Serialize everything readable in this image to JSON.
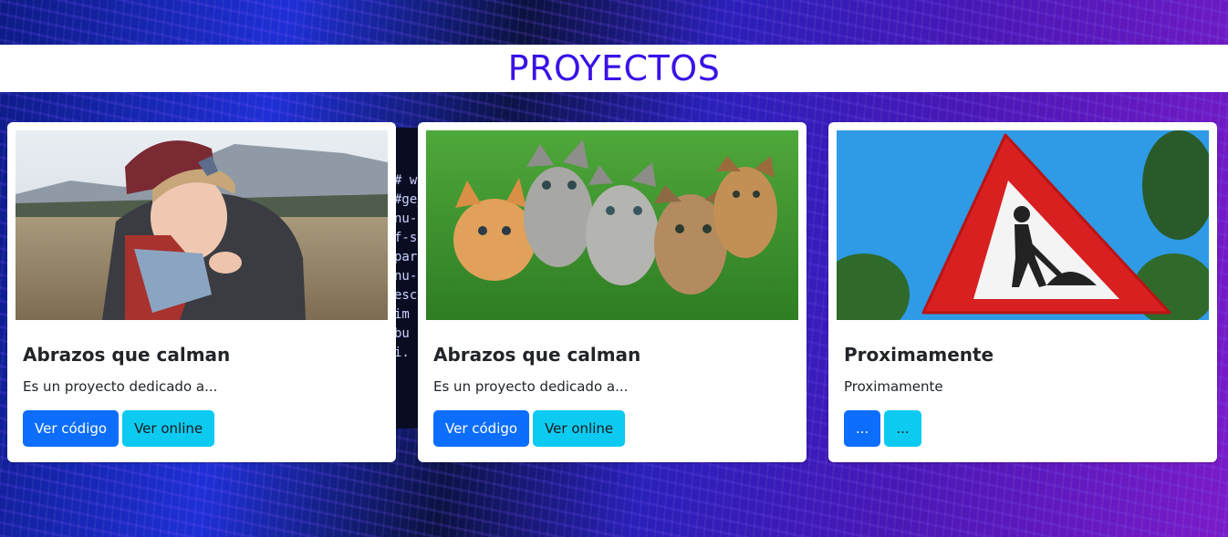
{
  "header": {
    "title": "PROYECTOS"
  },
  "code_strip": {
    "lines": [
      "# w",
      "#ge_",
      "nu-",
      "f-s",
      "par",
      "nu-",
      "esc",
      "im",
      "bu",
      "i."
    ]
  },
  "cards": [
    {
      "title": "Abrazos que calman",
      "text": "Es un proyecto dedicado a...",
      "image_alt": "Child hugging adult",
      "primary_label": "Ver código",
      "secondary_label": "Ver online"
    },
    {
      "title": "Abrazos que calman",
      "text": "Es un proyecto dedicado a...",
      "image_alt": "Five kittens on grass",
      "primary_label": "Ver código",
      "secondary_label": "Ver online"
    },
    {
      "title": "Proximamente",
      "text": "Proximamente",
      "image_alt": "Road works warning sign",
      "primary_label": "...",
      "secondary_label": "..."
    }
  ],
  "colors": {
    "title": "#3a12e6",
    "primary_button": "#0d6efd",
    "info_button": "#0dcaf0"
  }
}
